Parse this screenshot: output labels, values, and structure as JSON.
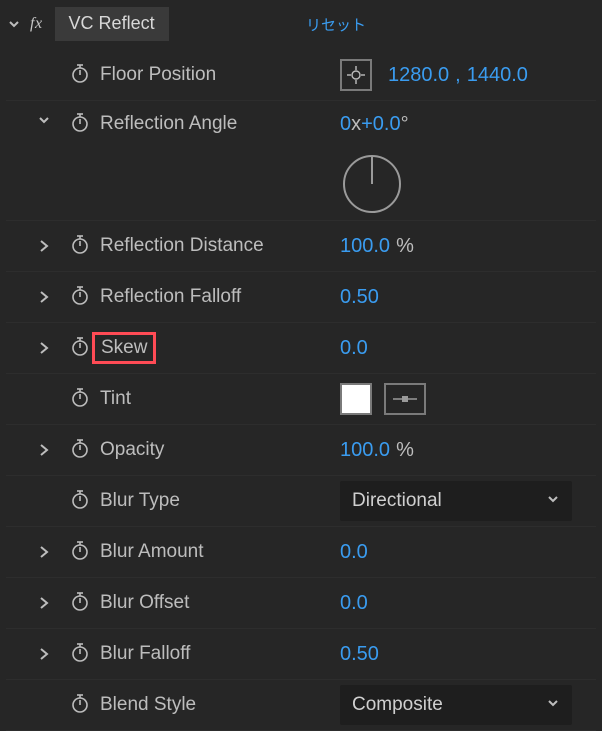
{
  "header": {
    "effect_name": "VC Reflect",
    "reset_label": "リセット"
  },
  "rows": {
    "floor_position": {
      "label": "Floor Position",
      "x": "1280.0",
      "y": "1440.0"
    },
    "reflection_angle": {
      "label": "Reflection Angle",
      "revs": "0",
      "sep": "x",
      "deg": "+0.0",
      "unit": "°"
    },
    "reflection_distance": {
      "label": "Reflection Distance",
      "value": "100.0",
      "suffix": "%"
    },
    "reflection_falloff": {
      "label": "Reflection Falloff",
      "value": "0.50"
    },
    "skew": {
      "label": "Skew",
      "value": "0.0"
    },
    "tint": {
      "label": "Tint"
    },
    "opacity": {
      "label": "Opacity",
      "value": "100.0",
      "suffix": "%"
    },
    "blur_type": {
      "label": "Blur Type",
      "value": "Directional"
    },
    "blur_amount": {
      "label": "Blur Amount",
      "value": "0.0"
    },
    "blur_offset": {
      "label": "Blur Offset",
      "value": "0.0"
    },
    "blur_falloff": {
      "label": "Blur Falloff",
      "value": "0.50"
    },
    "blend_style": {
      "label": "Blend Style",
      "value": "Composite"
    }
  }
}
